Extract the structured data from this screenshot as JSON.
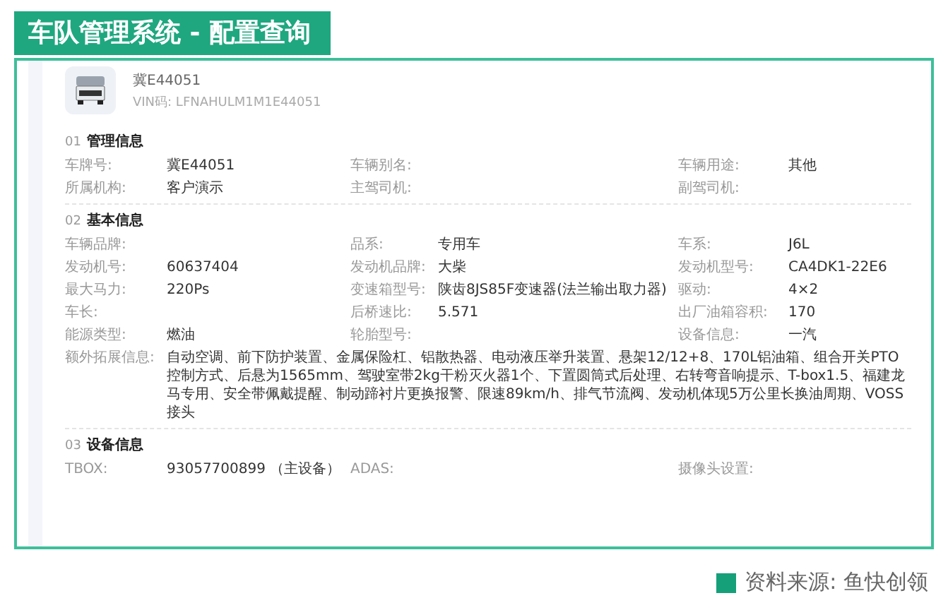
{
  "header": {
    "title": "车队管理系统 - 配置查询"
  },
  "vehicle": {
    "plate": "冀E44051",
    "vin": "VIN码: LFNAHULM1M1E44051"
  },
  "sections": [
    {
      "number": "01",
      "title": "管理信息",
      "fields": [
        {
          "label": "车牌号:",
          "value": "冀E44051"
        },
        {
          "label": "车辆别名:"
        },
        {
          "label": "车辆用途:",
          "value": "其他"
        },
        {
          "label": "所属机构:",
          "value": "客户演示"
        },
        {
          "label": "主驾司机:"
        },
        {
          "label": "副驾司机:"
        }
      ]
    },
    {
      "number": "02",
      "title": "基本信息",
      "fields": [
        {
          "label": "车辆品牌:"
        },
        {
          "label": "品系:",
          "value": "专用车"
        },
        {
          "label": "车系:",
          "value": "J6L"
        },
        {
          "label": "发动机号:",
          "value": "60637404"
        },
        {
          "label": "发动机品牌:",
          "value": "大柴"
        },
        {
          "label": "发动机型号:",
          "value": "CA4DK1-22E6"
        },
        {
          "label": "最大马力:",
          "value": "220Ps"
        },
        {
          "label": "变速箱型号:",
          "value": "陕齿8JS85F变速器(法兰输出取力器)"
        },
        {
          "label": "驱动:",
          "value": "4×2"
        },
        {
          "label": "车长:"
        },
        {
          "label": "后桥速比:",
          "value": "5.571"
        },
        {
          "label": "出厂油箱容积:",
          "value": "170"
        },
        {
          "label": "能源类型:",
          "value": "燃油"
        },
        {
          "label": "轮胎型号:"
        },
        {
          "label": "设备信息:",
          "value": "一汽"
        },
        {
          "label": "额外拓展信息:",
          "kind": "wide",
          "value": "自动空调、前下防护装置、金属保险杠、铝散热器、电动液压举升装置、悬架12/12+8、170L铝油箱、组合开关PTO控制方式、后悬为1565mm、驾驶室带2kg干粉灭火器1个、下置圆筒式后处理、右转弯音响提示、T-box1.5、福建龙马专用、安全带佩戴提醒、制动蹄衬片更换报警、限速89km/h、排气节流阀、发动机体现5万公里长换油周期、VOSS接头"
        }
      ]
    },
    {
      "number": "03",
      "title": "设备信息",
      "fields": [
        {
          "label": "TBOX:",
          "value": "93057700899 （主设备）"
        },
        {
          "label": "ADAS:"
        },
        {
          "label": "摄像头设置:"
        }
      ]
    }
  ],
  "source": {
    "text": "资料来源: 鱼快创领"
  }
}
